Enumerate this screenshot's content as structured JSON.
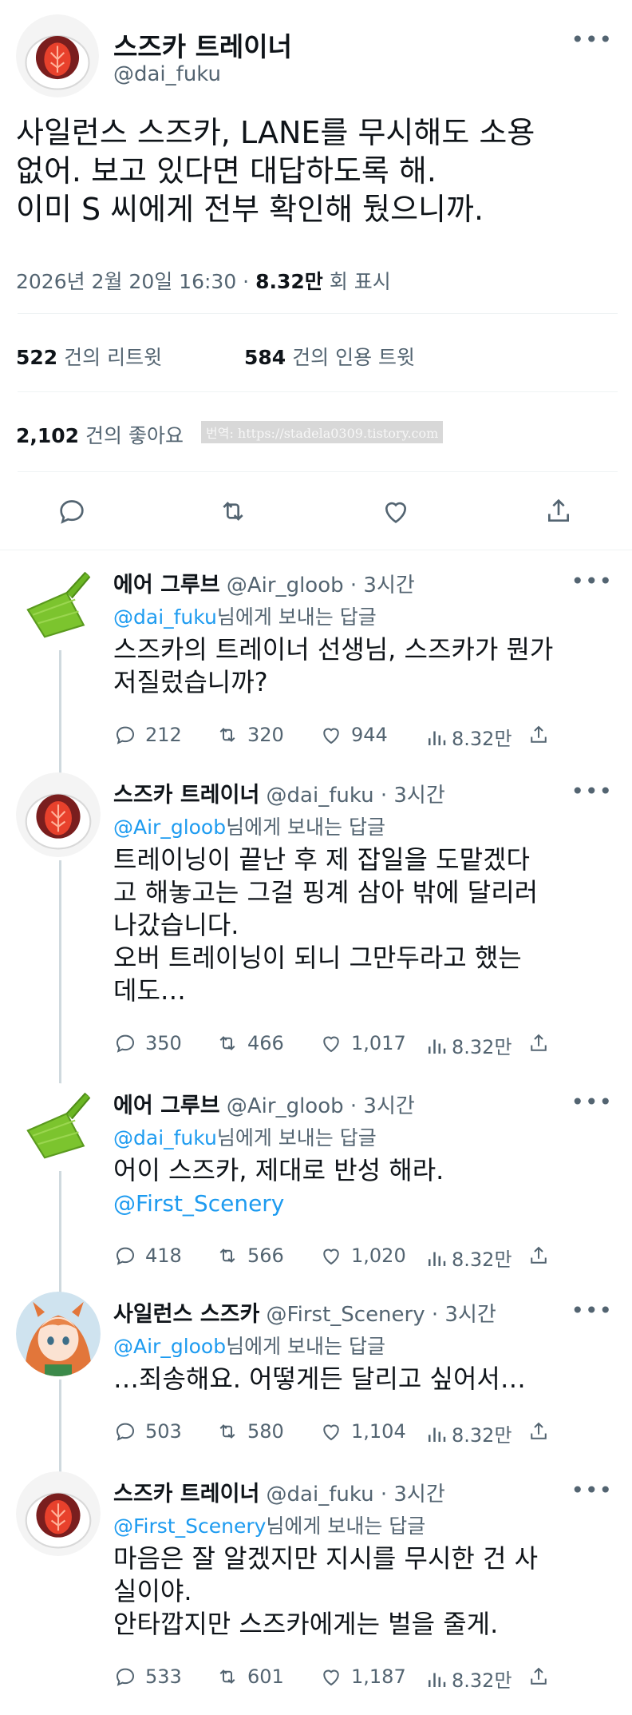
{
  "main_tweet": {
    "author_name": "스즈카 트레이너",
    "author_handle": "@dai_fuku",
    "text_lines": [
      "사일런스 스즈카, LANE를 무시해도 소용",
      "없어. 보고 있다면 대답하도록 해.",
      "이미 S 씨에게 전부 확인해 뒀으니까."
    ],
    "date": "2026년 2월 20일  16:30 ·",
    "views_value": "8.32만",
    "views_label": "회 표시",
    "retweets_count": "522",
    "retweets_label": "건의 리트윗",
    "quotes_count": "584",
    "quotes_label": "건의 인용 트윗",
    "likes_count": "2,102",
    "likes_label": "건의 좋아요",
    "watermark": "번역: https://stadela0309.tistory.com"
  },
  "replies": [
    {
      "author_name": "에어 그루브",
      "author_handle": "@Air_gloob · 3시간",
      "reply_to_handle": "@dai_fuku",
      "reply_to_suffix": "님에게 보내는 답글",
      "text_lines": [
        "스즈카의 트레이너 선생님, 스즈카가 뭔가",
        "저질렀습니까?"
      ],
      "mention": "",
      "replies": "212",
      "retweets": "320",
      "likes": "944",
      "views": "8.32만",
      "avatar": "dustpan"
    },
    {
      "author_name": "스즈카 트레이너",
      "author_handle": "@dai_fuku · 3시간",
      "reply_to_handle": "@Air_gloob",
      "reply_to_suffix": "님에게 보내는 답글",
      "text_lines": [
        "트레이닝이 끝난 후 제 잡일을 도맡겠다",
        "고 해놓고는 그걸 핑계 삼아 밖에 달리러",
        "나갔습니다.",
        "오버 트레이닝이 되니 그만두라고 했는",
        "데도…"
      ],
      "mention": "",
      "replies": "350",
      "retweets": "466",
      "likes": "1,017",
      "views": "8.32만",
      "avatar": "daifuku"
    },
    {
      "author_name": "에어 그루브",
      "author_handle": "@Air_gloob · 3시간",
      "reply_to_handle": "@dai_fuku",
      "reply_to_suffix": "님에게 보내는 답글",
      "text_lines": [
        "어이 스즈카, 제대로 반성 해라."
      ],
      "mention": "@First_Scenery",
      "replies": "418",
      "retweets": "566",
      "likes": "1,020",
      "views": "8.32만",
      "avatar": "dustpan"
    },
    {
      "author_name": "사일런스 스즈카",
      "author_handle": "@First_Scenery · 3시간",
      "reply_to_handle": "@Air_gloob",
      "reply_to_suffix": "님에게 보내는 답글",
      "text_lines": [
        "…죄송해요. 어떻게든 달리고 싶어서…"
      ],
      "mention": "",
      "replies": "503",
      "retweets": "580",
      "likes": "1,104",
      "views": "8.32만",
      "avatar": "suzuka"
    },
    {
      "author_name": "스즈카 트레이너",
      "author_handle": "@dai_fuku · 3시간",
      "reply_to_handle": "@First_Scenery",
      "reply_to_suffix": "님에게 보내는 답글",
      "text_lines": [
        "마음은 잘 알겠지만 지시를 무시한 건 사",
        "실이야.",
        "안타깝지만 스즈카에게는 벌을 줄게."
      ],
      "mention": "",
      "replies": "533",
      "retweets": "601",
      "likes": "1,187",
      "views": "8.32만",
      "avatar": "daifuku"
    }
  ],
  "colors": {
    "link": "#1d9bf0",
    "text": "#0f1419",
    "secondary": "#536471",
    "dustpan": "#7cc42e"
  }
}
